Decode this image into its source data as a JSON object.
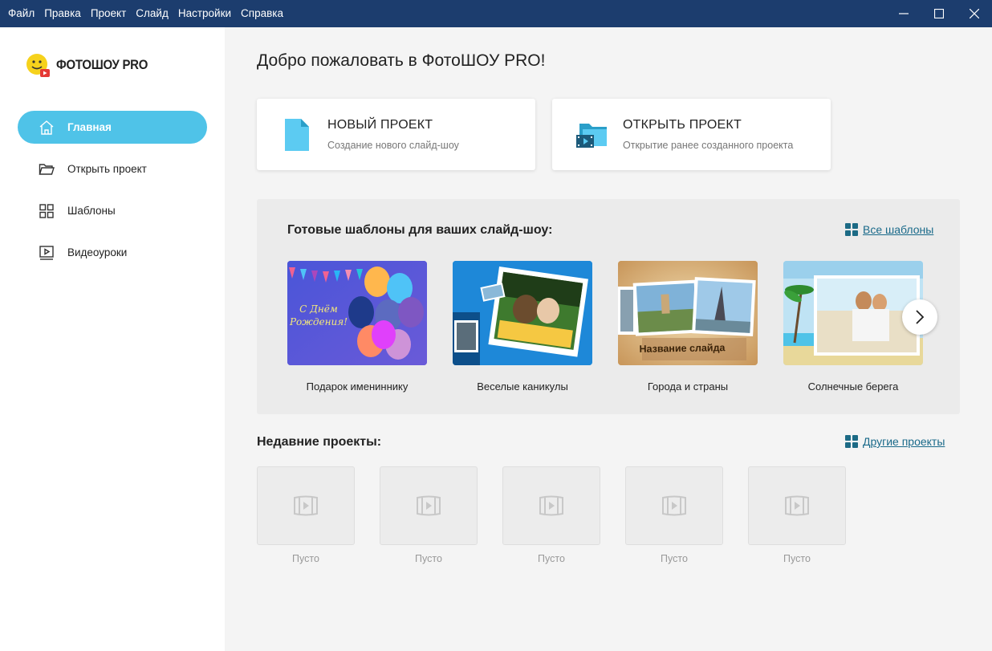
{
  "menu": [
    "Файл",
    "Правка",
    "Проект",
    "Слайд",
    "Настройки",
    "Справка"
  ],
  "window_controls": [
    "minimize-icon",
    "maximize-icon",
    "close-icon"
  ],
  "logo": {
    "text": "ФОТОШОУ PRO"
  },
  "sidebar": {
    "items": [
      {
        "label": "Главная",
        "icon": "home-icon",
        "active": true
      },
      {
        "label": "Открыть проект",
        "icon": "folder-icon",
        "active": false
      },
      {
        "label": "Шаблоны",
        "icon": "grid-icon",
        "active": false
      },
      {
        "label": "Видеоуроки",
        "icon": "video-icon",
        "active": false
      }
    ]
  },
  "main": {
    "welcome": "Добро пожаловать в ФотоШОУ PRO!",
    "actions": [
      {
        "title": "НОВЫЙ ПРОЕКТ",
        "subtitle": "Создание нового слайд-шоу",
        "icon": "new-file-icon"
      },
      {
        "title": "ОТКРЫТЬ ПРОЕКТ",
        "subtitle": "Открытие ранее созданного проекта",
        "icon": "open-folder-video-icon"
      }
    ],
    "templates": {
      "heading": "Готовые шаблоны для ваших слайд-шоу:",
      "all_link": "Все шаблоны",
      "items": [
        {
          "label": "Подарок имениннику",
          "thumb_text": "С Днём Рождения!"
        },
        {
          "label": "Веселые каникулы"
        },
        {
          "label": "Города и страны",
          "thumb_text": "Название слайда"
        },
        {
          "label": "Солнечные берега"
        }
      ]
    },
    "recent": {
      "heading": "Недавние проекты:",
      "other_link": "Другие проекты",
      "items": [
        "Пусто",
        "Пусто",
        "Пусто",
        "Пусто",
        "Пусто"
      ]
    }
  },
  "colors": {
    "menubar": "#1c3d6e",
    "accent": "#4fc3e8",
    "link": "#1a6a8a"
  }
}
